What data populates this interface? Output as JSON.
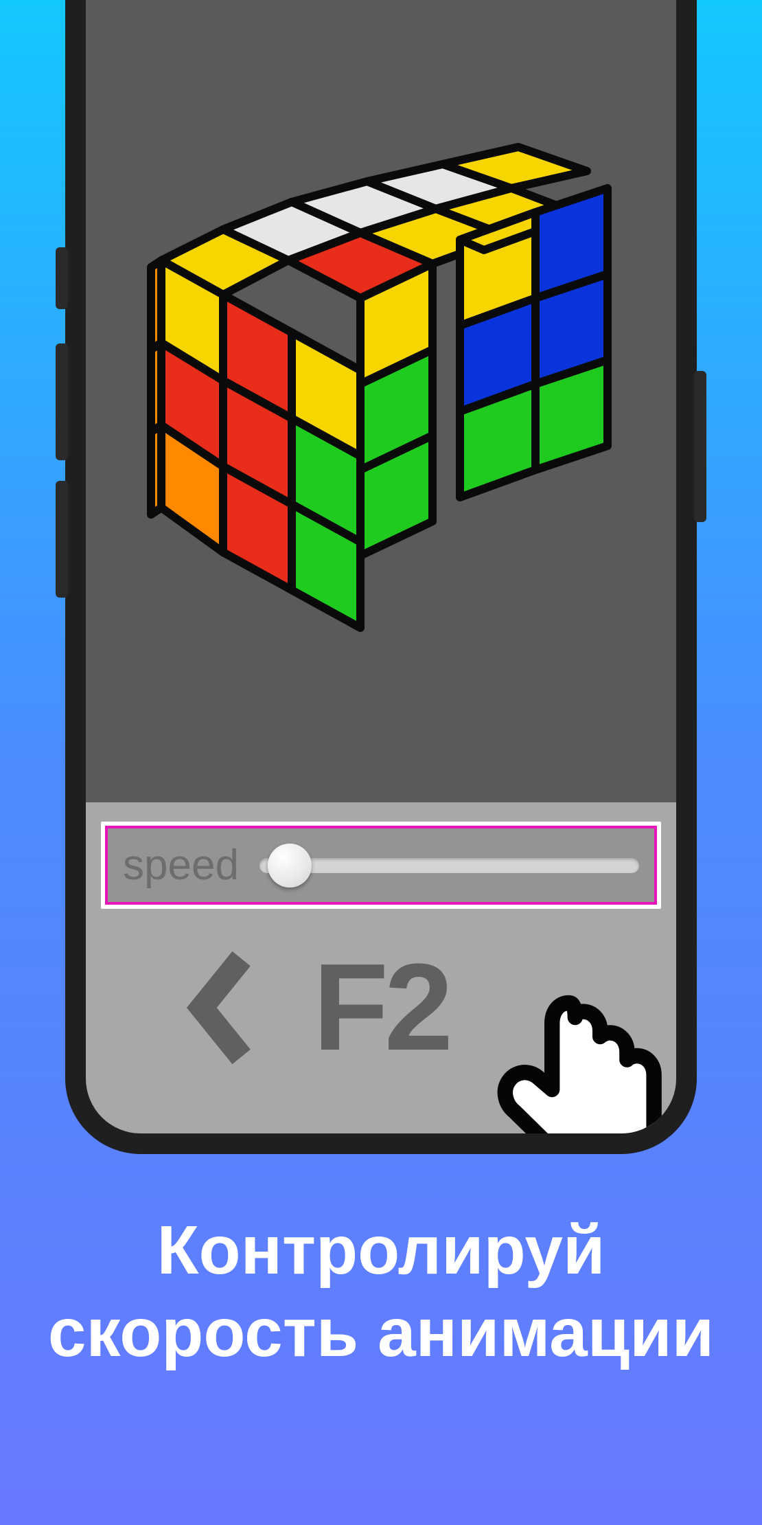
{
  "slider": {
    "label": "speed",
    "value_percent": 8
  },
  "move": {
    "label": "F2"
  },
  "caption": {
    "line1": "Контролируй",
    "line2": "скорость анимации"
  },
  "cube": {
    "colors": {
      "white": "#e6e6e6",
      "yellow": "#f7d500",
      "red": "#e82d1b",
      "orange": "#ff8a00",
      "green": "#1fcb1f",
      "blue": "#0a34db"
    },
    "front_face": [
      [
        "yellow",
        "red",
        "yellow"
      ],
      [
        "red",
        "red",
        "green"
      ],
      [
        "orange",
        "red",
        "green"
      ]
    ],
    "top_face": [
      [
        "white",
        "white",
        "yellow"
      ],
      [
        "white",
        "yellow",
        "yellow"
      ],
      [
        "yellow",
        "red",
        "yellow"
      ]
    ],
    "right_slices": {
      "slice_middle": [
        "yellow",
        "blue",
        "green"
      ],
      "slice_back": [
        "blue",
        "blue",
        "green"
      ]
    },
    "left_visible_column": [
      "orange",
      "orange",
      "orange"
    ]
  }
}
